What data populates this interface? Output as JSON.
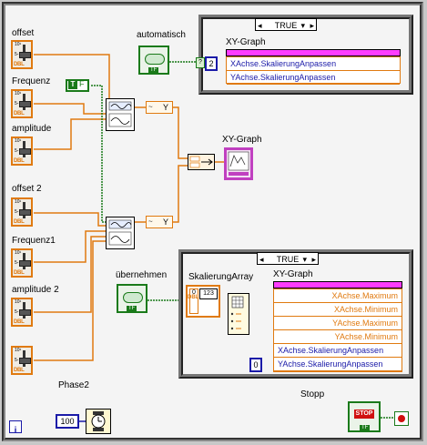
{
  "controls": {
    "offset": "offset",
    "frequenz": "Frequenz",
    "amplitude": "amplitude",
    "offset2": "offset 2",
    "frequenz1": "Frequenz1",
    "amplitude2": "amplitude 2",
    "phase2": "Phase2",
    "automatisch": "automatisch",
    "uebernehmen": "übernehmen",
    "stopp": "Stopp",
    "dbl_tag": "DBL",
    "tf_tag": "TF",
    "stop_button": "STOP",
    "tick_top": "10¹",
    "tick_mid": "5-",
    "tick_bot": "0-"
  },
  "case_top": {
    "selector": "TRUE",
    "left_arrow": "◂",
    "right_arrow": "▸",
    "dropdown": "▾",
    "graph_label": "XY-Graph",
    "props": [
      "XAchse.SkalierungAnpassen",
      "YAchse.SkalierungAnpassen"
    ],
    "const": "2"
  },
  "case_bottom": {
    "selector": "TRUE",
    "left_arrow": "◂",
    "right_arrow": "▸",
    "dropdown": "▾",
    "array_label": "SkalierungArray",
    "cluster_tag": "123",
    "graph_label": "XY-Graph",
    "props": [
      "XAchse.Maximum",
      "XAchse.Minimum",
      "YAchse.Maximum",
      "YAchse.Minimum",
      "XAchse.SkalierungAnpassen",
      "YAchse.SkalierungAnpassen"
    ],
    "const": "0"
  },
  "graph_indicator": {
    "label": "XY-Graph"
  },
  "true_const": "T",
  "wait_const": "100",
  "info_icon": "i",
  "y_label": "Y",
  "index_label": "0"
}
